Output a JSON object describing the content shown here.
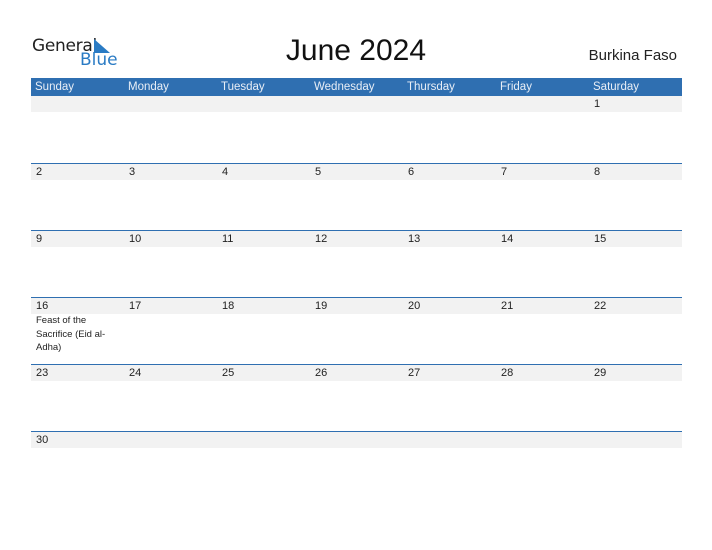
{
  "logo": {
    "word1": "General",
    "word2": "Blue"
  },
  "title": "June 2024",
  "country": "Burkina Faso",
  "colors": {
    "header_bg": "#2f6fb1",
    "accent": "#2a7bc4",
    "strip_bg": "#f2f2f2"
  },
  "weekdays": [
    "Sunday",
    "Monday",
    "Tuesday",
    "Wednesday",
    "Thursday",
    "Friday",
    "Saturday"
  ],
  "weeks": [
    {
      "days": [
        {
          "num": "",
          "event": ""
        },
        {
          "num": "",
          "event": ""
        },
        {
          "num": "",
          "event": ""
        },
        {
          "num": "",
          "event": ""
        },
        {
          "num": "",
          "event": ""
        },
        {
          "num": "",
          "event": ""
        },
        {
          "num": "1",
          "event": ""
        }
      ]
    },
    {
      "days": [
        {
          "num": "2",
          "event": ""
        },
        {
          "num": "3",
          "event": ""
        },
        {
          "num": "4",
          "event": ""
        },
        {
          "num": "5",
          "event": ""
        },
        {
          "num": "6",
          "event": ""
        },
        {
          "num": "7",
          "event": ""
        },
        {
          "num": "8",
          "event": ""
        }
      ]
    },
    {
      "days": [
        {
          "num": "9",
          "event": ""
        },
        {
          "num": "10",
          "event": ""
        },
        {
          "num": "11",
          "event": ""
        },
        {
          "num": "12",
          "event": ""
        },
        {
          "num": "13",
          "event": ""
        },
        {
          "num": "14",
          "event": ""
        },
        {
          "num": "15",
          "event": ""
        }
      ]
    },
    {
      "days": [
        {
          "num": "16",
          "event": "Feast of the Sacrifice (Eid al-Adha)"
        },
        {
          "num": "17",
          "event": ""
        },
        {
          "num": "18",
          "event": ""
        },
        {
          "num": "19",
          "event": ""
        },
        {
          "num": "20",
          "event": ""
        },
        {
          "num": "21",
          "event": ""
        },
        {
          "num": "22",
          "event": ""
        }
      ]
    },
    {
      "days": [
        {
          "num": "23",
          "event": ""
        },
        {
          "num": "24",
          "event": ""
        },
        {
          "num": "25",
          "event": ""
        },
        {
          "num": "26",
          "event": ""
        },
        {
          "num": "27",
          "event": ""
        },
        {
          "num": "28",
          "event": ""
        },
        {
          "num": "29",
          "event": ""
        }
      ]
    },
    {
      "days": [
        {
          "num": "30",
          "event": ""
        },
        {
          "num": "",
          "event": ""
        },
        {
          "num": "",
          "event": ""
        },
        {
          "num": "",
          "event": ""
        },
        {
          "num": "",
          "event": ""
        },
        {
          "num": "",
          "event": ""
        },
        {
          "num": "",
          "event": ""
        }
      ]
    }
  ]
}
